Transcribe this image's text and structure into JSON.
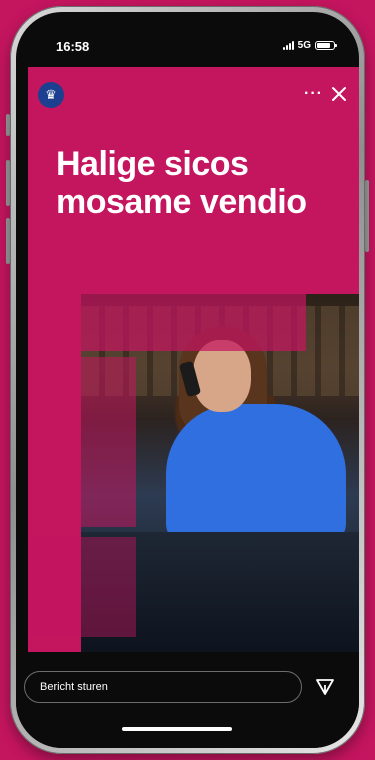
{
  "status_bar": {
    "time": "16:58",
    "network": "5G"
  },
  "story": {
    "headline_line1": "Halige sicos",
    "headline_line2": "mosame vendio",
    "account_logo": "crest-logo-icon",
    "more_icon": "more-dots-icon",
    "close_icon": "close-icon",
    "more_text": "···"
  },
  "reply": {
    "placeholder": "Bericht sturen",
    "send_icon": "send-icon"
  },
  "colors": {
    "brand_pink": "#c4155f",
    "logo_blue": "#1c3f8f"
  }
}
